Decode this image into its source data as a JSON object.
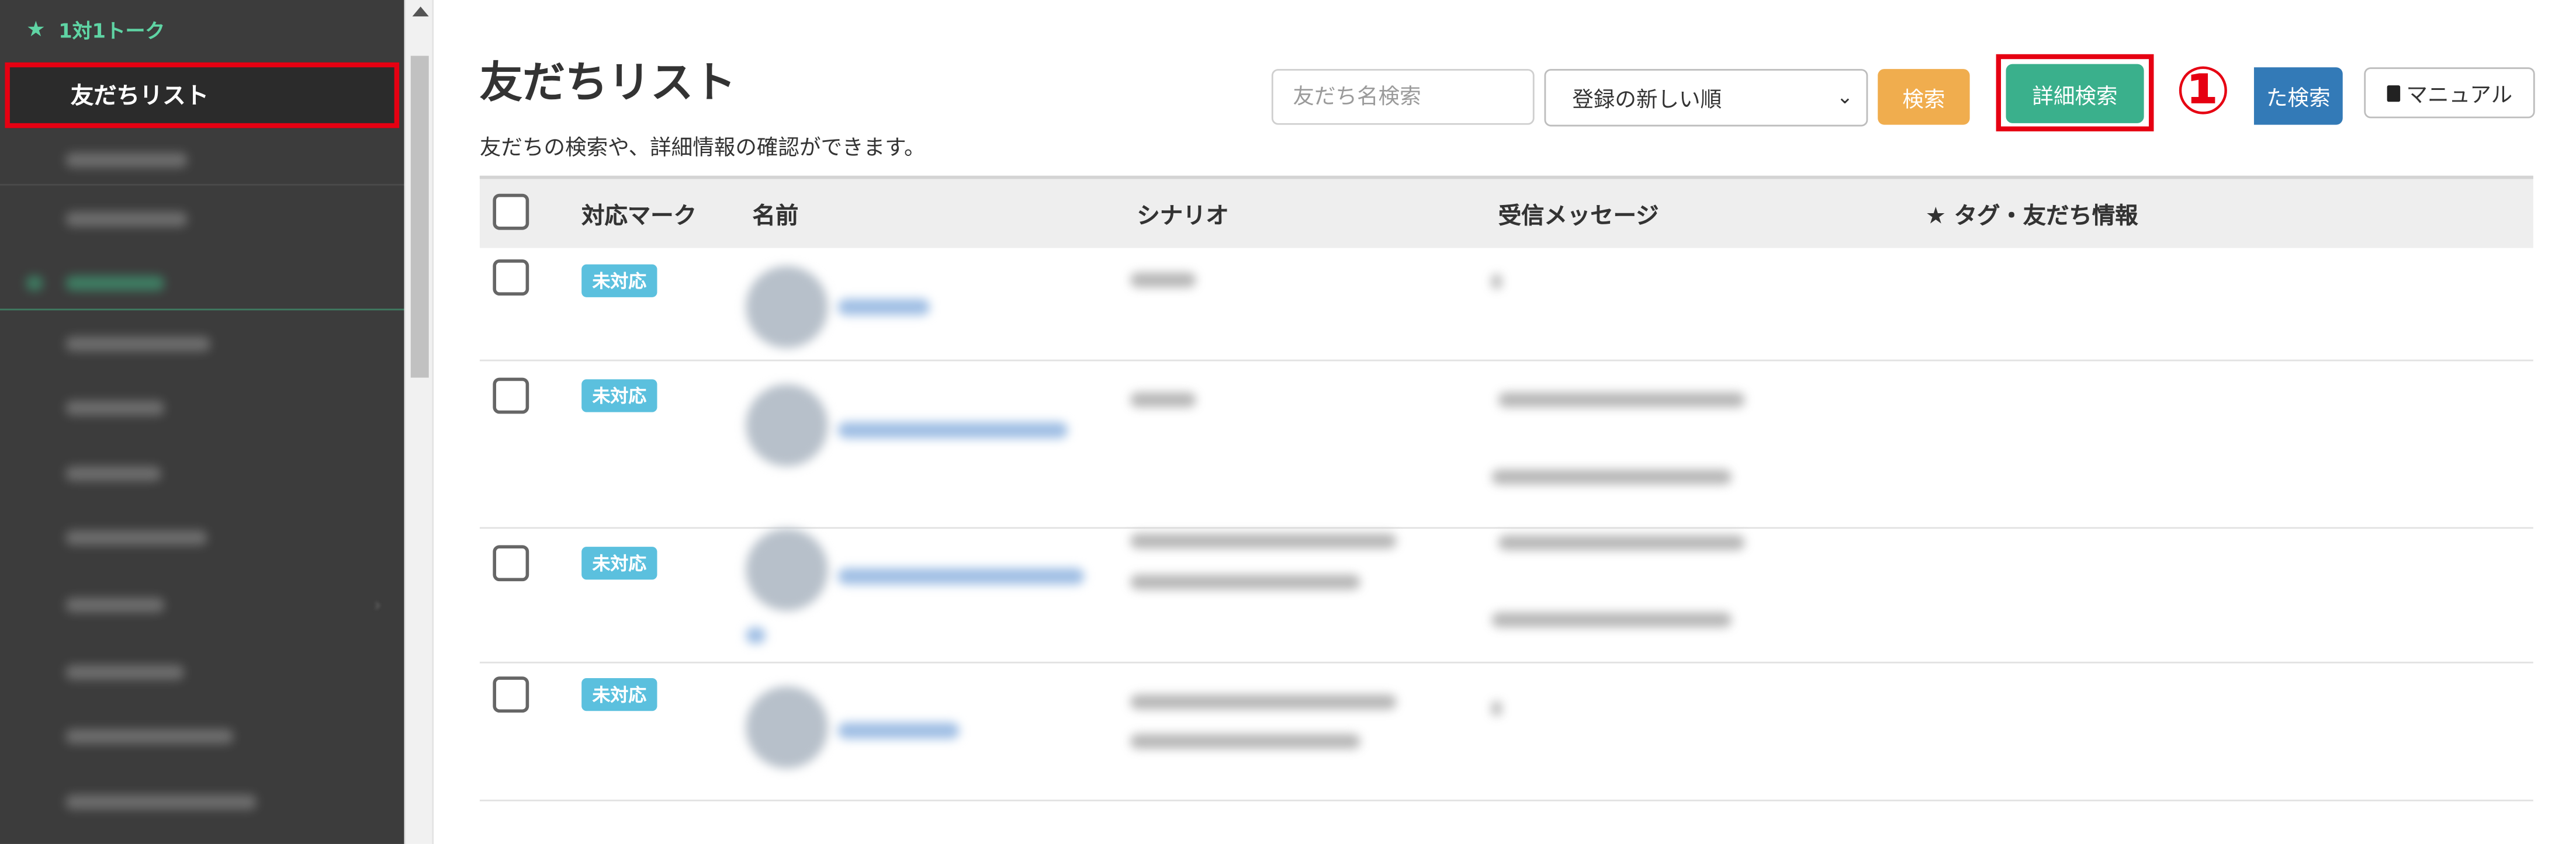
{
  "sidebar": {
    "section_title": "1対1トーク",
    "active_item": "友だちリスト"
  },
  "main": {
    "title": "友だちリスト",
    "description": "友だちの検索や、詳細情報の確認ができます。"
  },
  "toolbar": {
    "search_placeholder": "友だち名検索",
    "sort_selected": "登録の新しい順",
    "search_label": "検索",
    "detail_search_label": "詳細検索",
    "annotation_marker": "①",
    "saved_search_label": "た検索",
    "manual_label": "マニュアル"
  },
  "table": {
    "headers": [
      "対応マーク",
      "名前",
      "シナリオ",
      "受信メッセージ",
      "★ タグ・友だち情報"
    ],
    "rows": [
      {
        "status": "未対応"
      },
      {
        "status": "未対応"
      },
      {
        "status": "未対応"
      },
      {
        "status": "未対応"
      }
    ]
  },
  "colors": {
    "highlight": "#e60012",
    "detail_button": "#3ab08c",
    "search_button": "#f0ad4e",
    "saved_search_button": "#337ab7",
    "status_badge": "#5bc0de",
    "sidebar_bg": "#3c3c3c",
    "sidebar_section": "#5fd4a4"
  }
}
